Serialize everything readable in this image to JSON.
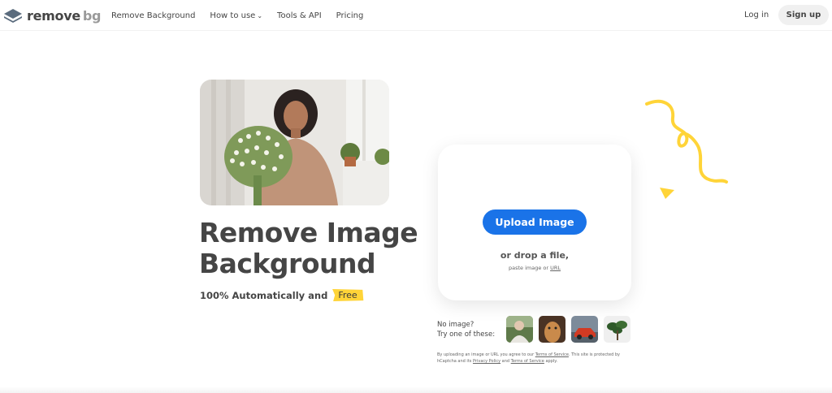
{
  "header": {
    "logo": {
      "word1": "remove",
      "word2": "bg"
    },
    "nav": [
      {
        "label": "Remove Background"
      },
      {
        "label": "How to use"
      },
      {
        "label": "Tools & API"
      },
      {
        "label": "Pricing"
      }
    ],
    "login_label": "Log in",
    "signup_label": "Sign up"
  },
  "hero": {
    "title_line1": "Remove Image",
    "title_line2": "Background",
    "subtitle": "100% Automatically and",
    "free_badge": "Free"
  },
  "upload": {
    "button_label": "Upload Image",
    "drop_text": "or drop a file,",
    "paste_text": "paste image or",
    "url_link": "URL"
  },
  "samples": {
    "line1": "No image?",
    "line2": "Try one of these:",
    "items": [
      "person-sample",
      "animal-sample",
      "car-sample",
      "plant-sample"
    ]
  },
  "legal": {
    "part1": "By uploading an image or URL you agree to our",
    "tos1": "Terms of Service",
    "part2": ". This site is protected by hCaptcha and its",
    "privacy": "Privacy Policy",
    "part3": "and",
    "tos2": "Terms of Service",
    "part4": "apply."
  },
  "colors": {
    "primary": "#1a73e8",
    "text": "#454545",
    "accent_yellow": "#ffd438"
  }
}
